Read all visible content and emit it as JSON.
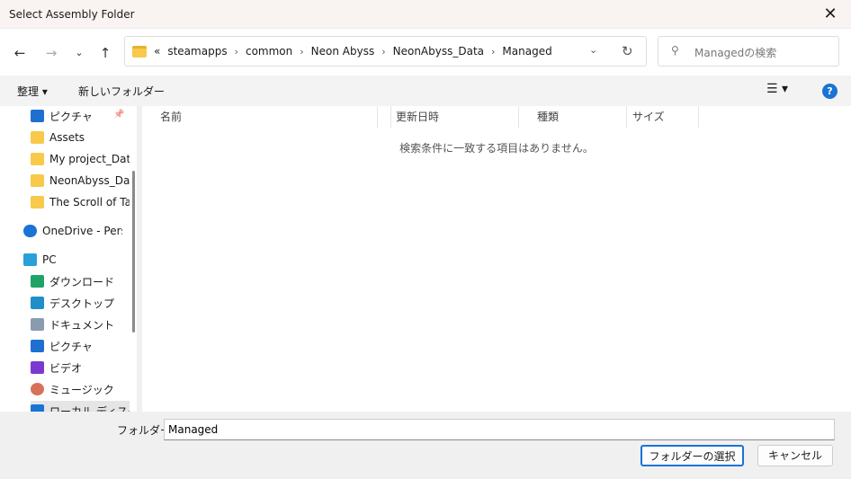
{
  "window": {
    "title": "Select Assembly Folder"
  },
  "address": {
    "overflow": "«",
    "crumbs": [
      "steamapps",
      "common",
      "Neon Abyss",
      "NeonAbyss_Data",
      "Managed"
    ]
  },
  "search": {
    "placeholder": "Managedの検索"
  },
  "toolbar": {
    "organize": "整理 ▾",
    "new_folder": "新しいフォルダー"
  },
  "sidebar": {
    "items": [
      {
        "label": "ピクチャ",
        "icon": "pictures-icon",
        "color": "#1f6fd1"
      },
      {
        "label": "Assets",
        "icon": "folder-icon",
        "color": "#f8c94a"
      },
      {
        "label": "My project_Data",
        "icon": "folder-icon",
        "color": "#f8c94a"
      },
      {
        "label": "NeonAbyss_Data",
        "icon": "folder-icon",
        "color": "#f8c94a"
      },
      {
        "label": "The Scroll of Taiwu",
        "icon": "folder-icon",
        "color": "#f8c94a"
      },
      {
        "label": "OneDrive - Personal",
        "icon": "cloud-icon",
        "color": "#1a73d6"
      },
      {
        "label": "PC",
        "icon": "pc-icon",
        "color": "#2aa0d8"
      },
      {
        "label": "ダウンロード",
        "icon": "download-icon",
        "color": "#21a366"
      },
      {
        "label": "デスクトップ",
        "icon": "desktop-icon",
        "color": "#1e8fc8"
      },
      {
        "label": "ドキュメント",
        "icon": "documents-icon",
        "color": "#8a9bb0"
      },
      {
        "label": "ピクチャ",
        "icon": "pictures-icon",
        "color": "#1f6fd1"
      },
      {
        "label": "ビデオ",
        "icon": "videos-icon",
        "color": "#7a3ad0"
      },
      {
        "label": "ミュージック",
        "icon": "music-icon",
        "color": "#d9705a"
      },
      {
        "label": "ローカル ディスク (C:)",
        "icon": "drive-icon",
        "color": "#1a73d6"
      }
    ]
  },
  "columns": [
    "名前",
    "更新日時",
    "種類",
    "サイズ"
  ],
  "empty_message": "検索条件に一致する項目はありません。",
  "footer": {
    "folder_label": "フォルダー:",
    "folder_value": "Managed",
    "select": "フォルダーの選択",
    "cancel": "キャンセル"
  }
}
